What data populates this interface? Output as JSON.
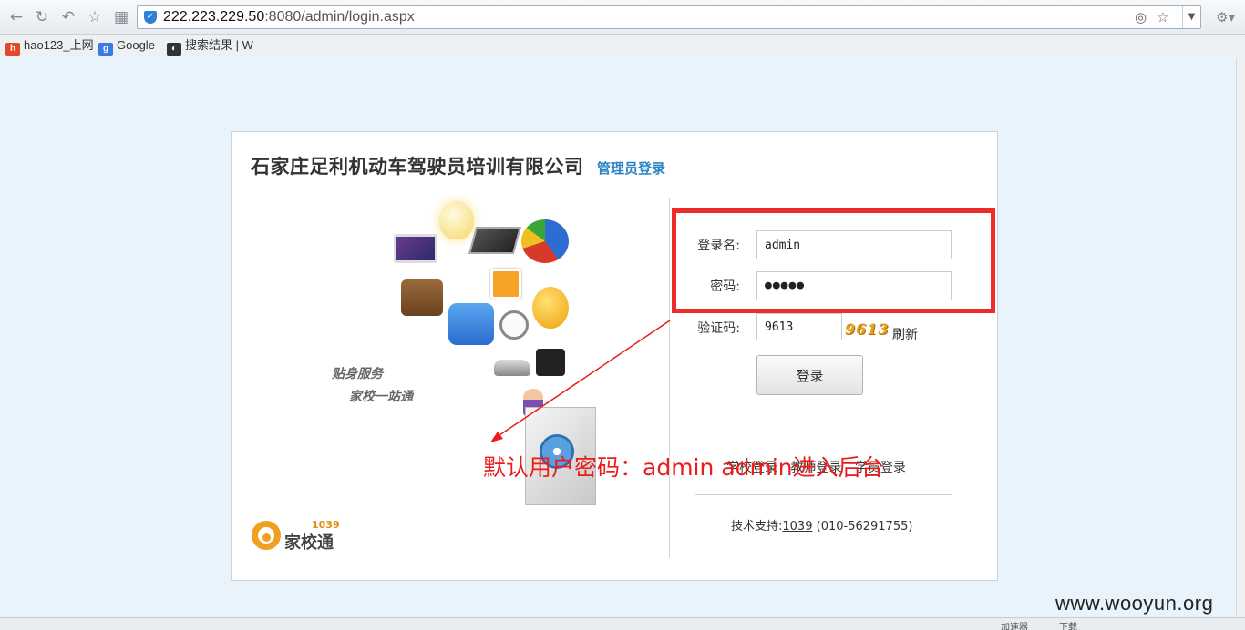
{
  "browser": {
    "url_host": "222.223.229.50",
    "url_path": ":8080/admin/login.aspx",
    "bookmarks": [
      {
        "label": "hao123_上网",
        "icon": "hao123-icon"
      },
      {
        "label": "Google",
        "icon": "google-icon"
      },
      {
        "label": "搜索结果 | W",
        "icon": "search-results-icon"
      }
    ]
  },
  "page": {
    "company": "石家庄足利机动车驾驶员培训有限公司",
    "subtitle": "管理员登录",
    "slogan1": "贴身服务",
    "slogan2": "家校一站通",
    "logo_number": "1039",
    "logo_name": "家校通"
  },
  "form": {
    "username_label": "登录名:",
    "username_value": "admin",
    "password_label": "密码:",
    "password_value": "●●●●●",
    "captcha_label": "验证码:",
    "captcha_value": "9613",
    "captcha_image_text": "9613",
    "refresh_label": "刷新",
    "submit_label": "登录"
  },
  "links": [
    "学校登录",
    "教师登录",
    "学员登录"
  ],
  "support": {
    "label": "技术支持:",
    "link": "1039",
    "phone": "(010-56291755)"
  },
  "annotation": {
    "text": "默认用户密码：admin  admin进入后台",
    "color": "#ea1c1c"
  },
  "watermark": "www.wooyun.org",
  "statusbar": {
    "accelerator": "加速器",
    "download": "下载"
  }
}
